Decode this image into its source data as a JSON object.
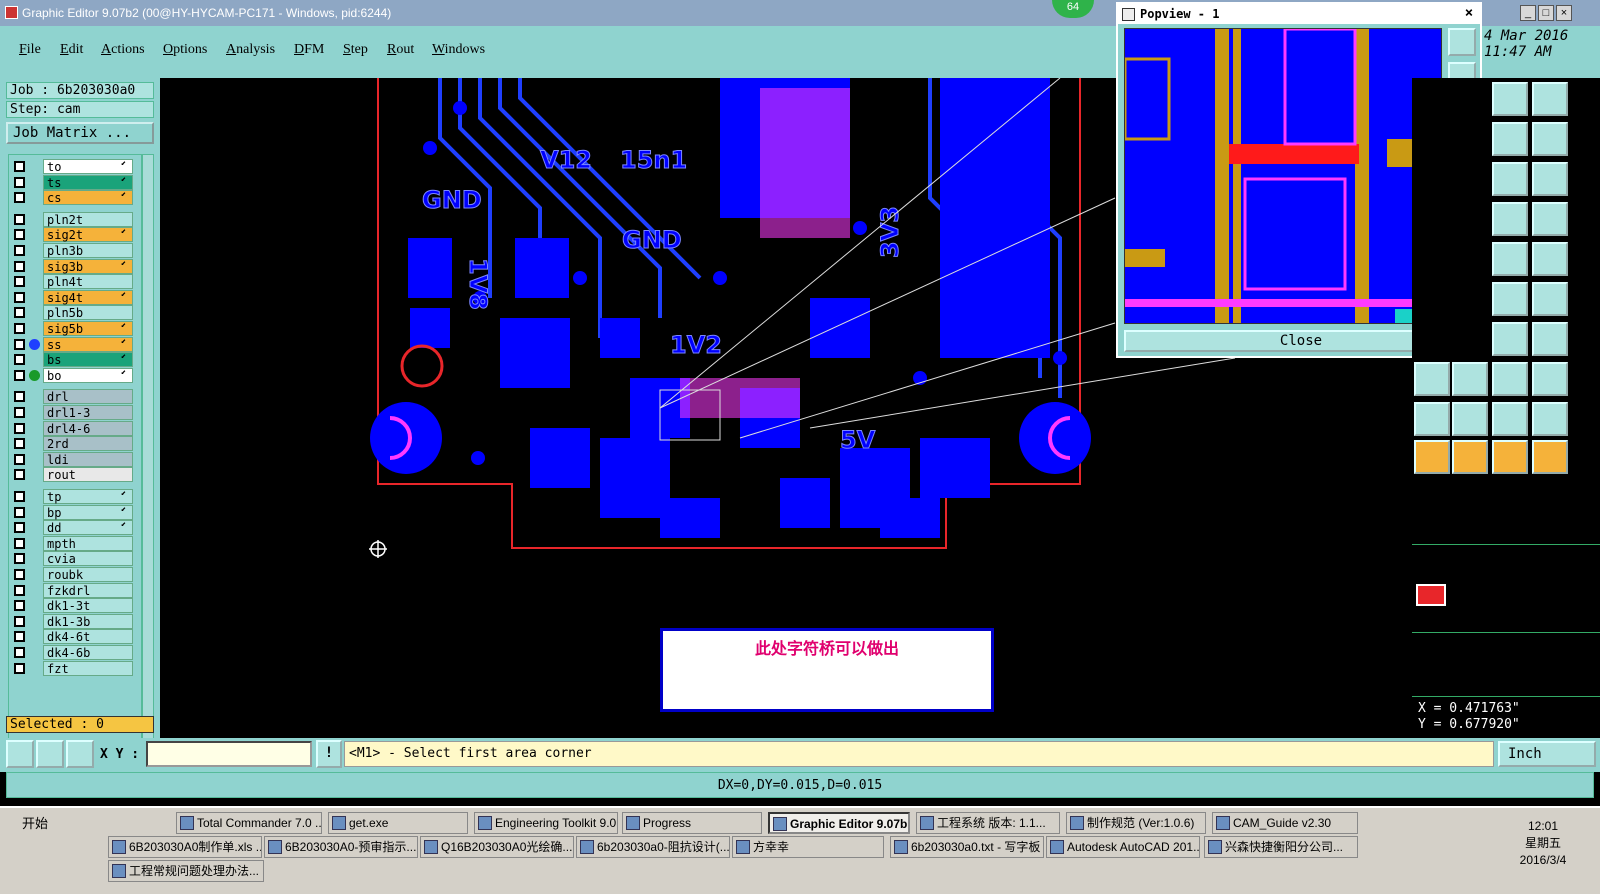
{
  "window": {
    "title": "Graphic Editor 9.07b2 (00@HY-HYCAM-PC171 - Windows, pid:6244)",
    "badge": "64"
  },
  "menu": [
    "File",
    "Edit",
    "Actions",
    "Options",
    "Analysis",
    "DFM",
    "Step",
    "Rout",
    "Windows"
  ],
  "datetime": {
    "date": "4 Mar 2016",
    "time": "11:47 AM"
  },
  "job": {
    "job_label": "Job : 6b203030a0",
    "step_label": "Step: cam",
    "matrix_button": "Job Matrix ..."
  },
  "layers": [
    {
      "name": "to",
      "color": "#ffffff",
      "mark": "⬋"
    },
    {
      "name": "ts",
      "color": "#1aa37a",
      "mark": "⬋"
    },
    {
      "name": "cs",
      "color": "#f5b23a",
      "mark": "⬋"
    },
    {
      "name": "pln2t",
      "color": "#aee3df",
      "mark": ""
    },
    {
      "name": "sig2t",
      "color": "#f5b23a",
      "mark": "⬋"
    },
    {
      "name": "pln3b",
      "color": "#aee3df",
      "mark": ""
    },
    {
      "name": "sig3b",
      "color": "#f5b23a",
      "mark": "⬋"
    },
    {
      "name": "pln4t",
      "color": "#aee3df",
      "mark": ""
    },
    {
      "name": "sig4t",
      "color": "#f5b23a",
      "mark": "⬋"
    },
    {
      "name": "pln5b",
      "color": "#aee3df",
      "mark": ""
    },
    {
      "name": "sig5b",
      "color": "#f5b23a",
      "mark": "⬋"
    },
    {
      "name": "ss",
      "color": "#f5b23a",
      "mark": "⬋",
      "dot": "#1f3fff"
    },
    {
      "name": "bs",
      "color": "#1aa37a",
      "mark": "⬋"
    },
    {
      "name": "bo",
      "color": "#ffffff",
      "mark": "⬋",
      "dot": "#1a9a2a"
    },
    {
      "name": "drl",
      "color": "#a8c0c8",
      "mark": ""
    },
    {
      "name": "drl1-3",
      "color": "#a8c0c8",
      "mark": ""
    },
    {
      "name": "drl4-6",
      "color": "#a8c0c8",
      "mark": ""
    },
    {
      "name": "2rd",
      "color": "#a8c0c8",
      "mark": ""
    },
    {
      "name": "ldi",
      "color": "#a8c0c8",
      "mark": ""
    },
    {
      "name": "rout",
      "color": "#e8e8e8",
      "mark": ""
    },
    {
      "name": "tp",
      "color": "#aee3df",
      "mark": "⬋"
    },
    {
      "name": "bp",
      "color": "#aee3df",
      "mark": "⬋"
    },
    {
      "name": "dd",
      "color": "#aee3df",
      "mark": "⬋"
    },
    {
      "name": "mpth",
      "color": "#aee3df",
      "mark": ""
    },
    {
      "name": "cvia",
      "color": "#aee3df",
      "mark": ""
    },
    {
      "name": "roubk",
      "color": "#aee3df",
      "mark": ""
    },
    {
      "name": "fzkdrl",
      "color": "#aee3df",
      "mark": ""
    },
    {
      "name": "dk1-3t",
      "color": "#aee3df",
      "mark": ""
    },
    {
      "name": "dk1-3b",
      "color": "#aee3df",
      "mark": ""
    },
    {
      "name": "dk4-6t",
      "color": "#aee3df",
      "mark": ""
    },
    {
      "name": "dk4-6b",
      "color": "#aee3df",
      "mark": ""
    },
    {
      "name": "fzt",
      "color": "#aee3df",
      "mark": ""
    }
  ],
  "selected": "Selected : 0",
  "popview": {
    "title": "Popview - 1",
    "close": "Close"
  },
  "board_labels": [
    "GND",
    "1V8",
    "GND",
    "3V3",
    "1V2",
    "5V",
    "V12",
    "15n1"
  ],
  "note": "此处字符桥可以做出",
  "coords": {
    "x": "X = 0.471763\"",
    "y": "Y = 0.677920\""
  },
  "cmd": {
    "xy_label": "X Y :",
    "xy_value": "",
    "prompt": "<M1> - Select first area corner",
    "units": "Inch"
  },
  "status": "DX=0,DY=0.015,D=0.015",
  "taskbar": {
    "start": "开始",
    "row1": [
      "Total Commander 7.0 ...",
      "get.exe",
      "Engineering Toolkit 9.0...",
      "Progress",
      "Graphic Editor 9.07b...",
      "工程系统  版本: 1.1...",
      "制作规范 (Ver:1.0.6)",
      "CAM_Guide v2.30"
    ],
    "row2": [
      "6B203030A0制作单.xls ...",
      "6B203030A0-预审指示...",
      "Q16B203030A0光绘确...",
      "6b203030a0-阻抗设计(...",
      "方幸幸",
      "6b203030a0.txt - 写字板",
      "Autodesk AutoCAD 201...",
      "兴森快捷衡阳分公司..."
    ],
    "row3": [
      "工程常规问题处理办法..."
    ],
    "clock": {
      "time": "12:01",
      "weekday": "星期五",
      "date": "2016/3/4"
    }
  }
}
